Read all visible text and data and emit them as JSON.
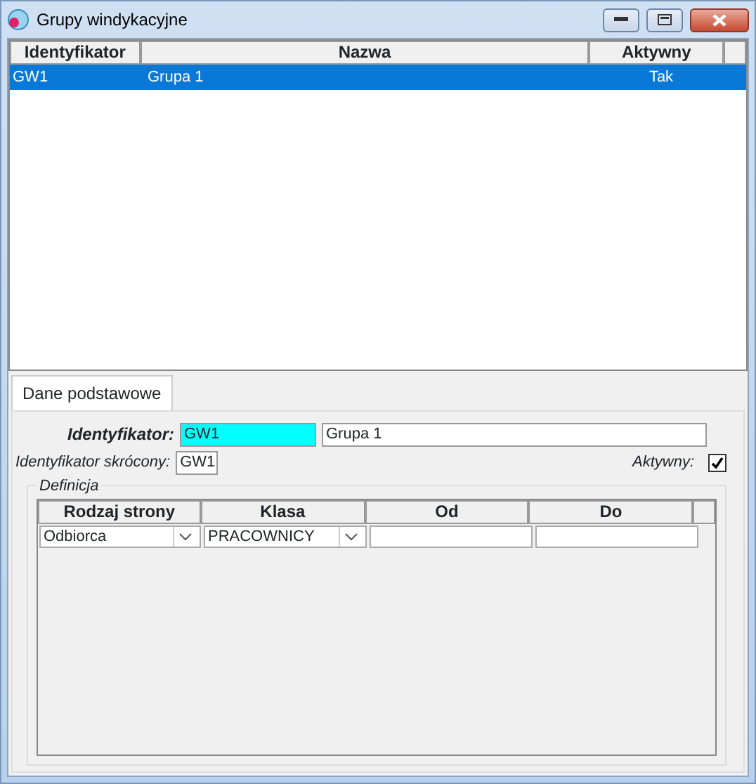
{
  "window": {
    "title": "Grupy windykacyjne"
  },
  "table": {
    "columns": [
      "Identyfikator",
      "Nazwa",
      "Aktywny"
    ],
    "rows": [
      {
        "cells": [
          "GW1",
          "Grupa 1",
          "Tak"
        ],
        "selected": true
      }
    ]
  },
  "tabs": [
    {
      "label": "Dane podstawowe",
      "selected": true
    }
  ],
  "form": {
    "id_label": "Identyfikator:",
    "id_value": "GW1",
    "name_value": "Grupa 1",
    "short_label": "Identyfikator skrócony:",
    "short_value": "GW1",
    "active_label": "Aktywny:",
    "active_checked": true
  },
  "definition": {
    "legend": "Definicja",
    "columns": [
      "Rodzaj strony",
      "Klasa",
      "Od",
      "Do"
    ],
    "rows": [
      {
        "rodzaj": "Odbiorca",
        "klasa": "PRACOWNICY",
        "od": "",
        "do": ""
      }
    ]
  }
}
